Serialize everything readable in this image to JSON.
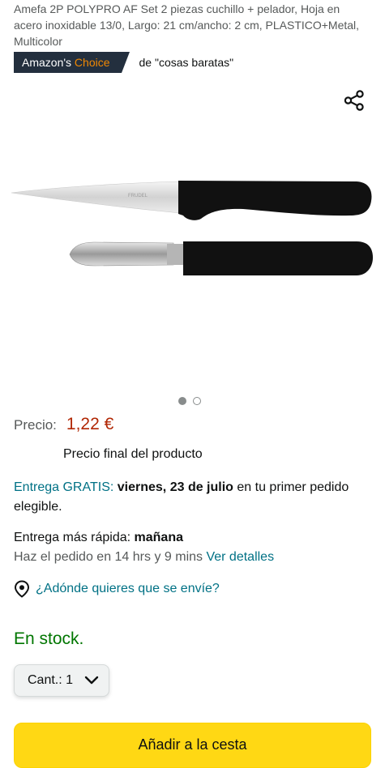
{
  "product": {
    "title": "Amefa 2P POLYPRO AF Set 2 piezas cuchillo + pelador, Hoja en acero inoxidable 13/0, Largo: 21 cm/ancho: 2 cm, PLASTICO+Metal, Multicolor",
    "badge_prefix": "Amazon's ",
    "badge_highlight": "Choice",
    "badge_context": "de \"cosas baratas\"",
    "blade_brand": "FRUDEL"
  },
  "icons": {
    "share": "share-icon",
    "location": "location-pin-icon",
    "dropdown": "chevron-down-icon"
  },
  "carousel": {
    "total": 2,
    "active_index": 0
  },
  "price": {
    "label": "Precio:",
    "value": "1,22 €",
    "note": "Precio final del producto"
  },
  "delivery": {
    "free_label": "Entrega GRATIS:",
    "date": "viernes, 23 de julio",
    "condition": "en tu primer pedido elegible."
  },
  "fast_delivery": {
    "label": "Entrega más rápida:",
    "value": "mañana",
    "countdown": "Haz el pedido en 14 hrs y 9 mins",
    "details_link": "Ver detalles"
  },
  "location": {
    "prompt": "¿Adónde quieres que se envíe?"
  },
  "stock": {
    "status": "En stock."
  },
  "quantity": {
    "label": "Cant.:",
    "value": "1"
  },
  "cart": {
    "add_label": "Añadir a la cesta"
  },
  "colors": {
    "price": "#b12704",
    "link": "#007185",
    "stock": "#007600",
    "badge_bg": "#232f3e",
    "badge_accent": "#f08804",
    "add_button": "#ffd814"
  }
}
